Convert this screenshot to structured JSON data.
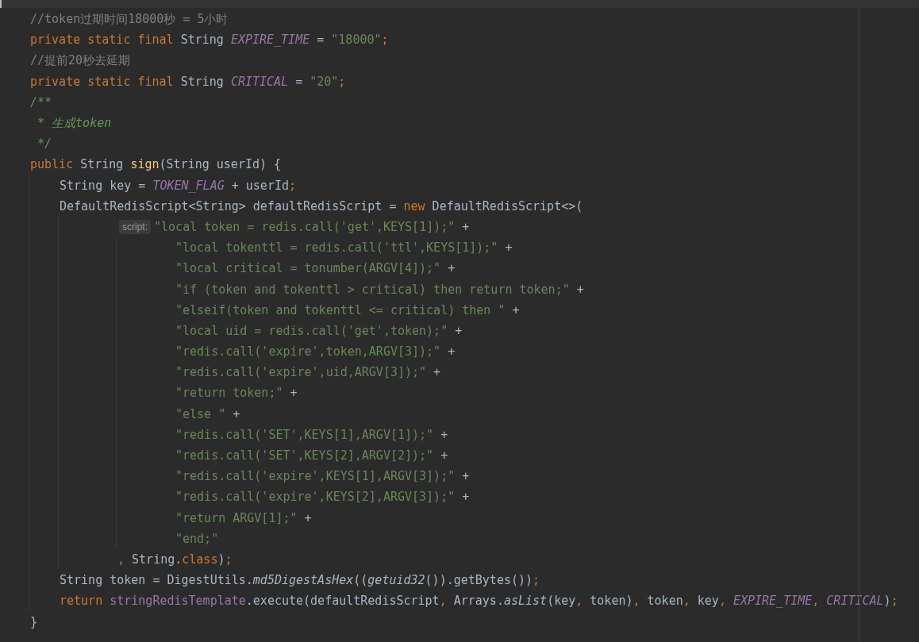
{
  "editor": {
    "lines": [
      {
        "tokens": [
          {
            "kind": "comment",
            "text": "//token过期时间18000秒 = 5小时"
          }
        ]
      },
      {
        "tokens": [
          {
            "kind": "kw",
            "text": "private static final "
          },
          {
            "kind": "plain",
            "text": "String "
          },
          {
            "kind": "const",
            "text": "EXPIRE_TIME"
          },
          {
            "kind": "plain",
            "text": " = "
          },
          {
            "kind": "str",
            "text": "\"18000\""
          },
          {
            "kind": "kw",
            "text": ";"
          }
        ]
      },
      {
        "tokens": [
          {
            "kind": "comment",
            "text": "//提前20秒去延期"
          }
        ]
      },
      {
        "tokens": [
          {
            "kind": "kw",
            "text": "private static final "
          },
          {
            "kind": "plain",
            "text": "String "
          },
          {
            "kind": "const",
            "text": "CRITICAL"
          },
          {
            "kind": "plain",
            "text": " = "
          },
          {
            "kind": "str",
            "text": "\"20\""
          },
          {
            "kind": "kw",
            "text": ";"
          }
        ]
      },
      {
        "tokens": [
          {
            "kind": "doc",
            "text": "/**"
          }
        ]
      },
      {
        "tokens": [
          {
            "kind": "doc",
            "text": " * 生成token"
          }
        ]
      },
      {
        "tokens": [
          {
            "kind": "doc",
            "text": " */"
          }
        ]
      },
      {
        "tokens": [
          {
            "kind": "kw",
            "text": "public "
          },
          {
            "kind": "plain",
            "text": "String "
          },
          {
            "kind": "method",
            "text": "sign"
          },
          {
            "kind": "plain",
            "text": "(String userId) {"
          }
        ],
        "wrap": false,
        "children": [
          {
            "tokens": [
              {
                "kind": "plain",
                "text": "String key = "
              },
              {
                "kind": "const",
                "text": "TOKEN_FLAG"
              },
              {
                "kind": "plain",
                "text": " + userId"
              },
              {
                "kind": "kw",
                "text": ";"
              }
            ]
          },
          {
            "tokens": [
              {
                "kind": "plain",
                "text": "DefaultRedisScript<String> defaultRedisScript = "
              },
              {
                "kind": "kw",
                "text": "new "
              },
              {
                "kind": "plain",
                "text": "DefaultRedisScript<>("
              }
            ],
            "wrap": true,
            "children": [
              {
                "hint": "script:",
                "tokens": [
                  {
                    "kind": "str",
                    "text": "\"local token = redis.call('get',KEYS[1]);\""
                  },
                  {
                    "kind": "plain",
                    "text": " +"
                  }
                ],
                "wrap": true,
                "children": [
                  {
                    "tokens": [
                      {
                        "kind": "str",
                        "text": "\"local tokenttl = redis.call('ttl',KEYS[1]);\""
                      },
                      {
                        "kind": "plain",
                        "text": " +"
                      }
                    ]
                  },
                  {
                    "tokens": [
                      {
                        "kind": "str",
                        "text": "\"local critical = tonumber(ARGV[4]);\""
                      },
                      {
                        "kind": "plain",
                        "text": " +"
                      }
                    ]
                  },
                  {
                    "tokens": [
                      {
                        "kind": "str",
                        "text": "\"if (token and tokenttl > critical) then return token;\""
                      },
                      {
                        "kind": "plain",
                        "text": " +"
                      }
                    ]
                  },
                  {
                    "tokens": [
                      {
                        "kind": "str",
                        "text": "\"elseif(token and tokenttl <= critical) then \""
                      },
                      {
                        "kind": "plain",
                        "text": " +"
                      }
                    ]
                  },
                  {
                    "tokens": [
                      {
                        "kind": "str",
                        "text": "\"local uid = redis.call('get',token);\""
                      },
                      {
                        "kind": "plain",
                        "text": " +"
                      }
                    ]
                  },
                  {
                    "tokens": [
                      {
                        "kind": "str",
                        "text": "\"redis.call('expire',token,ARGV[3]);\""
                      },
                      {
                        "kind": "plain",
                        "text": " +"
                      }
                    ]
                  },
                  {
                    "tokens": [
                      {
                        "kind": "str",
                        "text": "\"redis.call('expire',uid,ARGV[3]);\""
                      },
                      {
                        "kind": "plain",
                        "text": " +"
                      }
                    ]
                  },
                  {
                    "tokens": [
                      {
                        "kind": "str",
                        "text": "\"return token;\""
                      },
                      {
                        "kind": "plain",
                        "text": " +"
                      }
                    ]
                  },
                  {
                    "tokens": [
                      {
                        "kind": "str",
                        "text": "\"else \""
                      },
                      {
                        "kind": "plain",
                        "text": " +"
                      }
                    ]
                  },
                  {
                    "tokens": [
                      {
                        "kind": "str",
                        "text": "\"redis.call('SET',KEYS[1],ARGV[1]);\""
                      },
                      {
                        "kind": "plain",
                        "text": " +"
                      }
                    ]
                  },
                  {
                    "tokens": [
                      {
                        "kind": "str",
                        "text": "\"redis.call('SET',KEYS[2],ARGV[2]);\""
                      },
                      {
                        "kind": "plain",
                        "text": " +"
                      }
                    ]
                  },
                  {
                    "tokens": [
                      {
                        "kind": "str",
                        "text": "\"redis.call('expire',KEYS[1],ARGV[3]);\""
                      },
                      {
                        "kind": "plain",
                        "text": " +"
                      }
                    ]
                  },
                  {
                    "tokens": [
                      {
                        "kind": "str",
                        "text": "\"redis.call('expire',KEYS[2],ARGV[3]);\""
                      },
                      {
                        "kind": "plain",
                        "text": " +"
                      }
                    ]
                  },
                  {
                    "tokens": [
                      {
                        "kind": "str",
                        "text": "\"return ARGV[1];\""
                      },
                      {
                        "kind": "plain",
                        "text": " +"
                      }
                    ]
                  },
                  {
                    "tokens": [
                      {
                        "kind": "str",
                        "text": "\"end;\""
                      }
                    ]
                  }
                ]
              },
              {
                "tokens": [
                  {
                    "kind": "kw",
                    "text": ", "
                  },
                  {
                    "kind": "plain",
                    "text": "String."
                  },
                  {
                    "kind": "kw",
                    "text": "class"
                  },
                  {
                    "kind": "plain",
                    "text": ")"
                  },
                  {
                    "kind": "kw",
                    "text": ";"
                  }
                ]
              }
            ]
          },
          {
            "tokens": [
              {
                "kind": "plain",
                "text": "String token = DigestUtils."
              },
              {
                "kind": "static",
                "text": "md5DigestAsHex"
              },
              {
                "kind": "plain",
                "text": "(("
              },
              {
                "kind": "static",
                "text": "getuid32"
              },
              {
                "kind": "plain",
                "text": "()).getBytes())"
              },
              {
                "kind": "kw",
                "text": ";"
              }
            ]
          },
          {
            "tokens": [
              {
                "kind": "kw",
                "text": "return "
              },
              {
                "kind": "field",
                "text": "stringRedisTemplate"
              },
              {
                "kind": "plain",
                "text": ".execute(defaultRedisScript"
              },
              {
                "kind": "kw",
                "text": ", "
              },
              {
                "kind": "plain",
                "text": "Arrays."
              },
              {
                "kind": "static",
                "text": "asList"
              },
              {
                "kind": "plain",
                "text": "(key"
              },
              {
                "kind": "kw",
                "text": ", "
              },
              {
                "kind": "plain",
                "text": "token)"
              },
              {
                "kind": "kw",
                "text": ", "
              },
              {
                "kind": "plain",
                "text": "token"
              },
              {
                "kind": "kw",
                "text": ", "
              },
              {
                "kind": "plain",
                "text": "key"
              },
              {
                "kind": "kw",
                "text": ", "
              },
              {
                "kind": "const",
                "text": "EXPIRE_TIME"
              },
              {
                "kind": "kw",
                "text": ", "
              },
              {
                "kind": "const",
                "text": "CRITICAL"
              },
              {
                "kind": "plain",
                "text": ")"
              },
              {
                "kind": "kw",
                "text": ";"
              }
            ]
          }
        ]
      },
      {
        "tokens": [
          {
            "kind": "plain",
            "text": "}"
          }
        ]
      }
    ]
  }
}
